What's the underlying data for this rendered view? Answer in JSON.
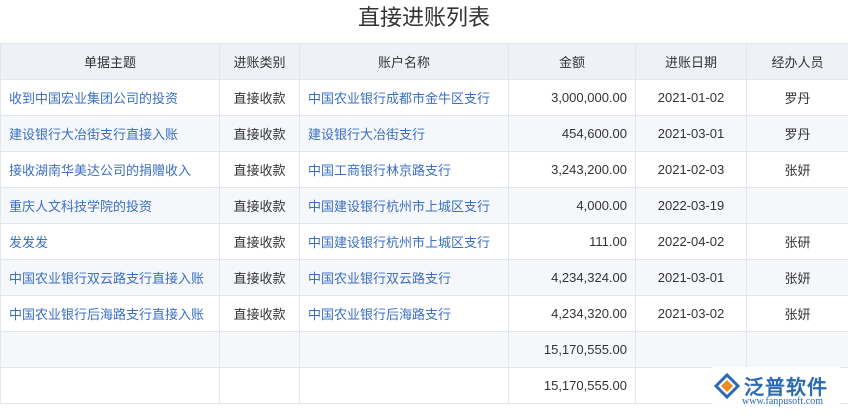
{
  "page": {
    "title": "直接进账列表"
  },
  "table": {
    "headers": [
      "单据主题",
      "进账类别",
      "账户名称",
      "金额",
      "进账日期",
      "经办人员"
    ],
    "rows": [
      [
        "收到中国宏业集团公司的投资",
        "直接收款",
        "中国农业银行成都市金牛区支行",
        "3,000,000.00",
        "2021-01-02",
        "罗丹"
      ],
      [
        "建设银行大冶街支行直接入账",
        "直接收款",
        "建设银行大冶街支行",
        "454,600.00",
        "2021-03-01",
        "罗丹"
      ],
      [
        "接收湖南华美达公司的捐赠收入",
        "直接收款",
        "中国工商银行林京路支行",
        "3,243,200.00",
        "2021-02-03",
        "张妍"
      ],
      [
        "重庆人文科技学院的投资",
        "直接收款",
        "中国建设银行杭州市上城区支行",
        "4,000.00",
        "2022-03-19",
        ""
      ],
      [
        "发发发",
        "直接收款",
        "中国建设银行杭州市上城区支行",
        "111.00",
        "2022-04-02",
        "张研"
      ],
      [
        "中国农业银行双云路支行直接入账",
        "直接收款",
        "中国农业银行双云路支行",
        "4,234,324.00",
        "2021-03-01",
        "张妍"
      ],
      [
        "中国农业银行后海路支行直接入账",
        "直接收款",
        "中国农业银行后海路支行",
        "4,234,320.00",
        "2021-03-02",
        "张妍"
      ]
    ],
    "subtotal": "15,170,555.00",
    "total": "15,170,555.00"
  },
  "logo": {
    "name": "泛普软件",
    "url": "www.fanpusoft.com",
    "color": "#2a6ab5",
    "accent": "#f08a24"
  }
}
